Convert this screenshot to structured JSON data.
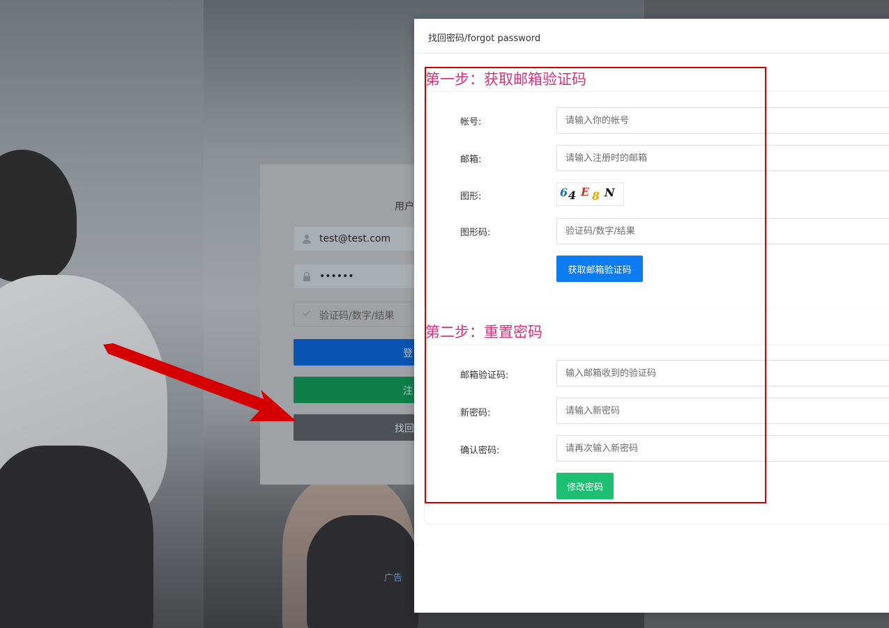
{
  "background": {
    "ad_alt": "广告"
  },
  "login": {
    "title": "用户",
    "username_value": "test@test.com",
    "password_value": "••••••",
    "captcha_placeholder": "验证码/数字/结果",
    "login_label": "登",
    "register_label": "注",
    "forgot_label": "找回"
  },
  "modal": {
    "title": "找回密码/forgot password",
    "step1": {
      "title": "第一步：获取邮箱验证码",
      "account_label": "帐号:",
      "account_placeholder": "请输入你的帐号",
      "email_label": "邮箱:",
      "email_placeholder": "请输入注册时的邮箱",
      "graphic_label": "图形:",
      "captcha_chars": [
        "6",
        "4",
        "E",
        "8",
        "N"
      ],
      "captcha_colors": [
        "#1b6fb2",
        "#111111",
        "#c0392b",
        "#e0a800",
        "#111111"
      ],
      "graphic_code_label": "图形码:",
      "graphic_code_placeholder": "验证码/数字/结果",
      "submit_label": "获取邮箱验证码"
    },
    "step2": {
      "title": "第二步：重置密码",
      "email_code_label": "邮箱验证码:",
      "email_code_placeholder": "输入邮箱收到的验证码",
      "new_password_label": "新密码:",
      "new_password_placeholder": "请输入新密码",
      "confirm_password_label": "确认密码:",
      "confirm_password_placeholder": "请再次输入新密码",
      "submit_label": "修改密码"
    }
  },
  "colors": {
    "step_title": "#d6337f",
    "primary_button": "#0d7cf2",
    "success_button": "#1dbf73",
    "annotation_red": "#d00000"
  }
}
